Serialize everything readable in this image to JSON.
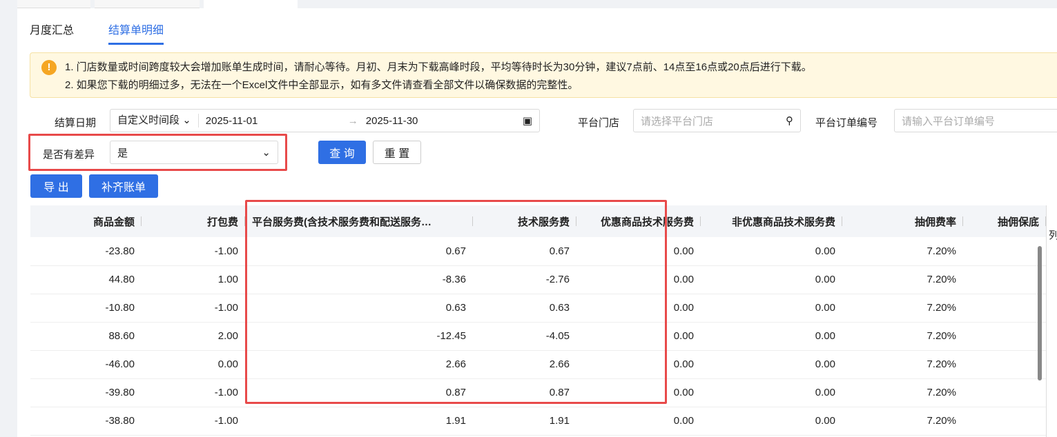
{
  "subtabs": [
    "月度汇总",
    "结算单明细"
  ],
  "alert": {
    "line1": "1. 门店数量或时间跨度较大会增加账单生成时间，请耐心等待。月初、月末为下载高峰时段，平均等待时长为30分钟，建议7点前、14点至16点或20点后进行下载。",
    "line2": "2. 如果您下载的明细过多，无法在一个Excel文件中全部显示，如有多文件请查看全部文件以确保数据的完整性。",
    "icon": "warning-icon"
  },
  "filters": {
    "date_label": "结算日期",
    "date_type": "自定义时间段",
    "start": "2025-11-01",
    "arrow": "→",
    "end": "2025-11-30",
    "store_label": "平台门店",
    "store_ph": "请选择平台门店",
    "order_label": "平台订单编号",
    "order_ph": "请输入平台订单编号",
    "diff_label": "是否有差异",
    "diff_value": "是"
  },
  "buttons": {
    "query": "查 询",
    "reset": "重 置",
    "export": "导 出",
    "supplement": "补齐账单"
  },
  "table": {
    "headers": [
      "商品金额",
      "打包费",
      "平台服务费(含技术服务费和配送服务…",
      "技术服务费",
      "优惠商品技术服务费",
      "非优惠商品技术服务费",
      "抽佣费率",
      "抽佣保底"
    ],
    "rows": [
      [
        "-23.80",
        "-1.00",
        "0.67",
        "0.67",
        "0.00",
        "0.00",
        "7.20%",
        ""
      ],
      [
        "44.80",
        "1.00",
        "-8.36",
        "-2.76",
        "0.00",
        "0.00",
        "7.20%",
        ""
      ],
      [
        "-10.80",
        "-1.00",
        "0.63",
        "0.63",
        "0.00",
        "0.00",
        "7.20%",
        ""
      ],
      [
        "88.60",
        "2.00",
        "-12.45",
        "-4.05",
        "0.00",
        "0.00",
        "7.20%",
        ""
      ],
      [
        "-46.00",
        "0.00",
        "2.66",
        "2.66",
        "0.00",
        "0.00",
        "7.20%",
        ""
      ],
      [
        "-39.80",
        "-1.00",
        "0.87",
        "0.87",
        "0.00",
        "0.00",
        "7.20%",
        ""
      ],
      [
        "-38.80",
        "-1.00",
        "1.91",
        "1.91",
        "0.00",
        "0.00",
        "7.20%",
        ""
      ]
    ]
  },
  "side_label": "列",
  "colors": {
    "primary": "#2f6fe4",
    "highlight": "#e84a4a",
    "alert_bg": "#fff8e1"
  }
}
